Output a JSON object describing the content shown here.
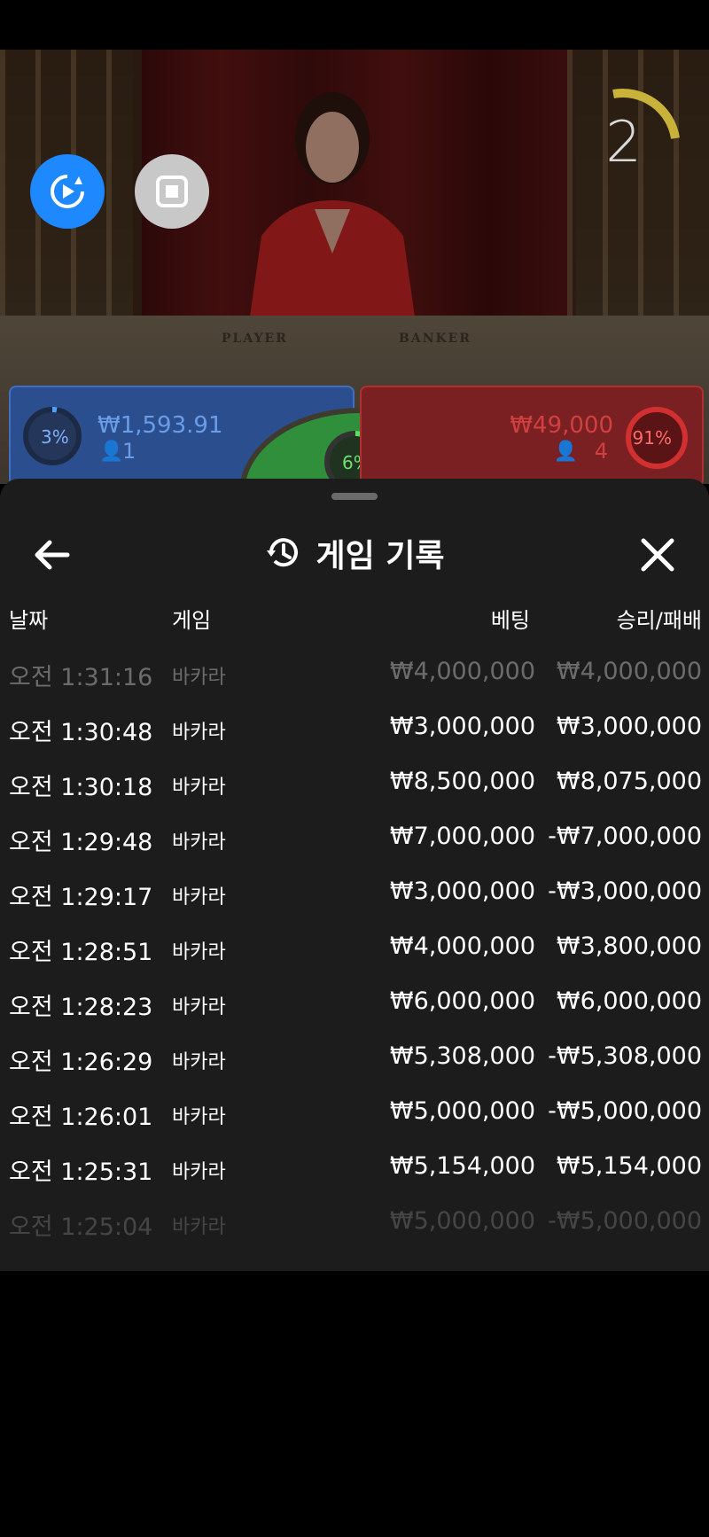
{
  "stream": {
    "round_counter": "2",
    "table_text": {
      "player": "PLAYER",
      "banker": "BANKER"
    }
  },
  "bets": {
    "player": {
      "percent": "3%",
      "amount": "₩1,593.91",
      "players": "1"
    },
    "tie": {
      "percent": "6%"
    },
    "banker": {
      "percent": "91%",
      "amount": "₩49,000",
      "players": "4"
    }
  },
  "history": {
    "title": "게임 기록",
    "columns": {
      "date": "날짜",
      "game": "게임",
      "bet": "베팅",
      "result": "승리/패배"
    },
    "rows": [
      {
        "date": "오전 1:31:16",
        "game": "바카라",
        "bet": "₩4,000,000",
        "result": "₩4,000,000"
      },
      {
        "date": "오전 1:30:48",
        "game": "바카라",
        "bet": "₩3,000,000",
        "result": "₩3,000,000"
      },
      {
        "date": "오전 1:30:18",
        "game": "바카라",
        "bet": "₩8,500,000",
        "result": "₩8,075,000"
      },
      {
        "date": "오전 1:29:48",
        "game": "바카라",
        "bet": "₩7,000,000",
        "result": "-₩7,000,000"
      },
      {
        "date": "오전 1:29:17",
        "game": "바카라",
        "bet": "₩3,000,000",
        "result": "-₩3,000,000"
      },
      {
        "date": "오전 1:28:51",
        "game": "바카라",
        "bet": "₩4,000,000",
        "result": "₩3,800,000"
      },
      {
        "date": "오전 1:28:23",
        "game": "바카라",
        "bet": "₩6,000,000",
        "result": "₩6,000,000"
      },
      {
        "date": "오전 1:26:29",
        "game": "바카라",
        "bet": "₩5,308,000",
        "result": "-₩5,308,000"
      },
      {
        "date": "오전 1:26:01",
        "game": "바카라",
        "bet": "₩5,000,000",
        "result": "-₩5,000,000"
      },
      {
        "date": "오전 1:25:31",
        "game": "바카라",
        "bet": "₩5,154,000",
        "result": "₩5,154,000"
      },
      {
        "date": "오전 1:25:04",
        "game": "바카라",
        "bet": "₩5,000,000",
        "result": "-₩5,000,000"
      }
    ]
  },
  "colors": {
    "accent_blue": "#1e88ff",
    "sheet_bg": "#1c1c1c",
    "player_blue": "#2b4f8e",
    "banker_red": "#7a1f22",
    "tie_green": "#2f8f3a"
  }
}
